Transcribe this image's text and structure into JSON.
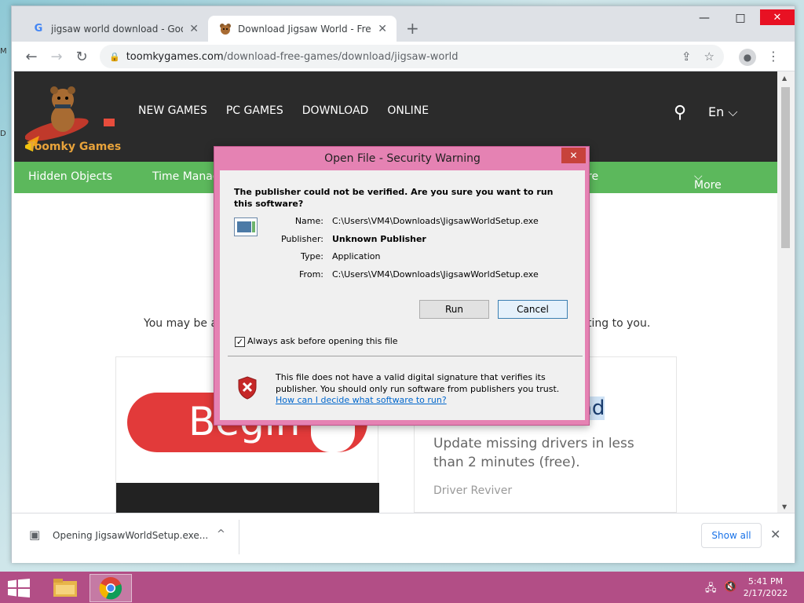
{
  "desktop": {
    "marks": [
      "M",
      "D"
    ]
  },
  "browser": {
    "tabs": [
      {
        "title": "jigsaw world download - Google",
        "favicon": "G"
      },
      {
        "title": "Download Jigsaw World - Free P",
        "favicon": "bear-favicon"
      }
    ],
    "new_tab": "+",
    "controls": {
      "minimize": "—",
      "maximize": "□",
      "close": "✕"
    },
    "url_host": "toomkygames.com",
    "url_path": "/download-free-games/download/jigsaw-world"
  },
  "site": {
    "logo_text": "Toomky Games",
    "topnav": [
      "NEW GAMES",
      "PC GAMES",
      "DOWNLOAD",
      "ONLINE"
    ],
    "lang": "En",
    "categories": [
      "Hidden Objects",
      "Time Manag",
      "re",
      "More"
    ],
    "maybe_left": "You may be a",
    "maybe_right": "ting to you."
  },
  "ads": {
    "begin_text": "Begin",
    "right_headline": "ad",
    "right_body": "Update missing drivers in less than 2 minutes (free).",
    "right_brand": "Driver Reviver"
  },
  "dialog": {
    "title": "Open File - Security Warning",
    "question": "The publisher could not be verified.  Are you sure you want to run this software?",
    "fields": [
      {
        "key": "Name:",
        "value": "C:\\Users\\VM4\\Downloads\\JigsawWorldSetup.exe"
      },
      {
        "key": "Publisher:",
        "value": "Unknown Publisher"
      },
      {
        "key": "Type:",
        "value": "Application"
      },
      {
        "key": "From:",
        "value": "C:\\Users\\VM4\\Downloads\\JigsawWorldSetup.exe"
      }
    ],
    "run_label": "Run",
    "cancel_label": "Cancel",
    "checkbox_label": "Always ask before opening this file",
    "checkbox_checked": true,
    "warning": "This file does not have a valid digital signature that verifies its publisher.  You should only run software from publishers you trust.",
    "help_link": "How can I decide what software to run?"
  },
  "download_bar": {
    "item": "Opening JigsawWorldSetup.exe...",
    "show_all": "Show all"
  },
  "taskbar": {
    "time": "5:41 PM",
    "date": "2/17/2022",
    "accent": "#b24e86"
  }
}
